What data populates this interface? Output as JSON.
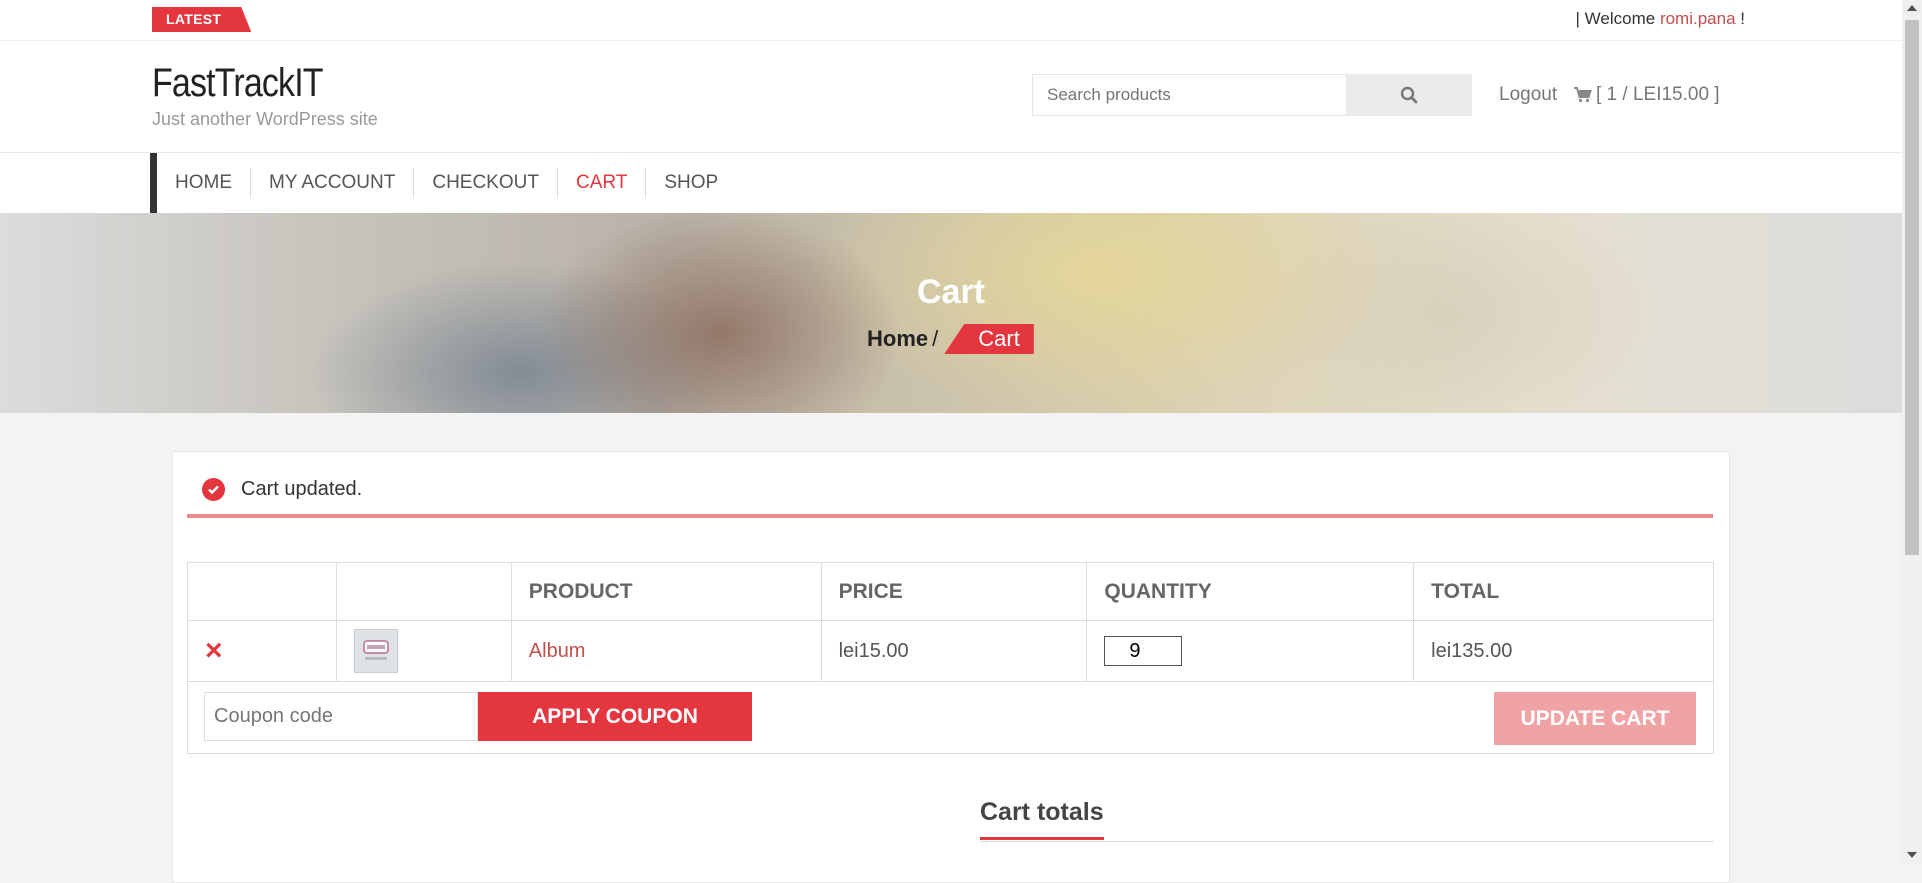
{
  "topbar": {
    "latest_label": "LATEST",
    "welcome_prefix": "| Welcome ",
    "username": "romi.pana",
    "welcome_suffix": " !"
  },
  "header": {
    "site_title": "FastTrackIT",
    "tagline": "Just another WordPress site",
    "search_placeholder": "Search products",
    "logout": "Logout",
    "cart_summary": "[ 1 / LEI15.00 ]"
  },
  "nav": {
    "items": [
      "HOME",
      "MY ACCOUNT",
      "CHECKOUT",
      "CART",
      "SHOP"
    ],
    "active": "CART"
  },
  "hero": {
    "title": "Cart",
    "crumb_home": "Home",
    "crumb_sep": "/",
    "crumb_current": "Cart"
  },
  "notice": {
    "message": "Cart updated."
  },
  "cart_table": {
    "headers": [
      "",
      "",
      "PRODUCT",
      "PRICE",
      "QUANTITY",
      "TOTAL"
    ],
    "rows": [
      {
        "remove": "×",
        "product": "Album",
        "price": "lei15.00",
        "quantity": "9",
        "total": "lei135.00"
      }
    ]
  },
  "actions": {
    "coupon_placeholder": "Coupon code",
    "apply_label": "APPLY COUPON",
    "update_label": "UPDATE CART"
  },
  "totals": {
    "title": "Cart totals"
  },
  "colors": {
    "accent": "#e3363f",
    "accent_light": "#f0a3a5"
  }
}
